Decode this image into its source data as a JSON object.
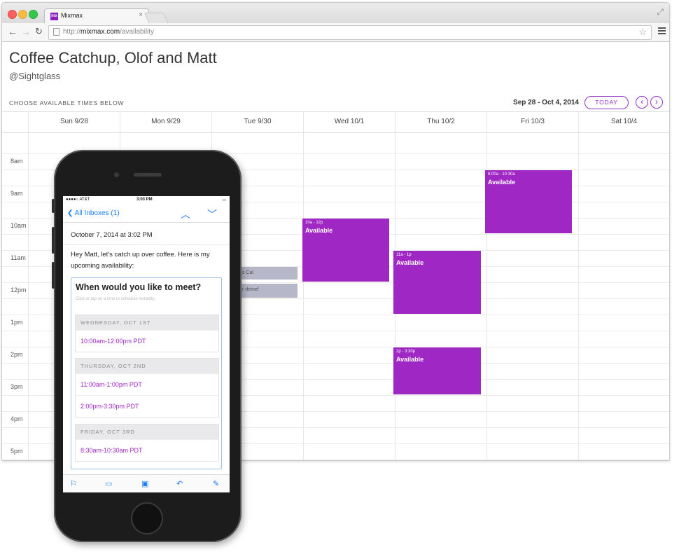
{
  "browser": {
    "tab_title": "Mixmax",
    "tab_favicon": "mx",
    "url_prefix": "http://",
    "url_domain": "mixmax.com",
    "url_path": "/availability"
  },
  "page": {
    "title": "Coffee Catchup, Olof and Matt",
    "location": "@Sightglass",
    "instruction": "CHOOSE AVAILABLE TIMES BELOW",
    "date_range": "Sep 28 - Oct 4, 2014",
    "today_label": "TODAY",
    "prev_icon": "‹",
    "next_icon": "›"
  },
  "calendar": {
    "days": [
      "Sun 9/28",
      "Mon 9/29",
      "Tue 9/30",
      "Wed 10/1",
      "Thu 10/2",
      "Fri 10/3",
      "Sat 10/4"
    ],
    "times": [
      "8am",
      "9am",
      "10am",
      "11am",
      "12pm",
      "1pm",
      "2pm",
      "3pm",
      "4pm",
      "5pm"
    ],
    "events": [
      {
        "time": "8:00a - 10:30a",
        "label": "Available"
      },
      {
        "time": "10a - 12p",
        "label": "Available"
      },
      {
        "time": "11a - 1p",
        "label": "Available"
      },
      {
        "time": "2p - 3:30p",
        "label": "Available"
      }
    ],
    "busy": [
      {
        "label": "s Cal"
      },
      {
        "label": "r detnef"
      }
    ],
    "event_color": "#9f27c4"
  },
  "phone": {
    "carrier": "●●●●○ AT&T  ",
    "clock": "3:03 PM",
    "battery": "▭",
    "back_label": "❮ All Inboxes (1)",
    "nav_arrows": "︿ ﹀",
    "date": "October 7, 2014 at 3:02 PM",
    "body": "Hey Matt, let's catch up over coffee. Here is my upcoming availability:",
    "widget_title": "When would you like to meet?",
    "widget_hint": "Click or tap on a time to schedule instantly.",
    "days": [
      {
        "header": "WEDNESDAY, OCT 1ST",
        "slots": [
          "10:00am-12:00pm PDT"
        ]
      },
      {
        "header": "THURSDAY, OCT 2ND",
        "slots": [
          "11:00am-1:00pm PDT",
          "2:00pm-3:30pm PDT"
        ]
      },
      {
        "header": "FRIDAY, OCT 3RD",
        "slots": [
          "8:30am-10:30am PDT"
        ]
      }
    ],
    "toolbar_icons": [
      "flag-icon",
      "folder-icon",
      "archive-icon",
      "reply-icon",
      "compose-icon"
    ]
  }
}
